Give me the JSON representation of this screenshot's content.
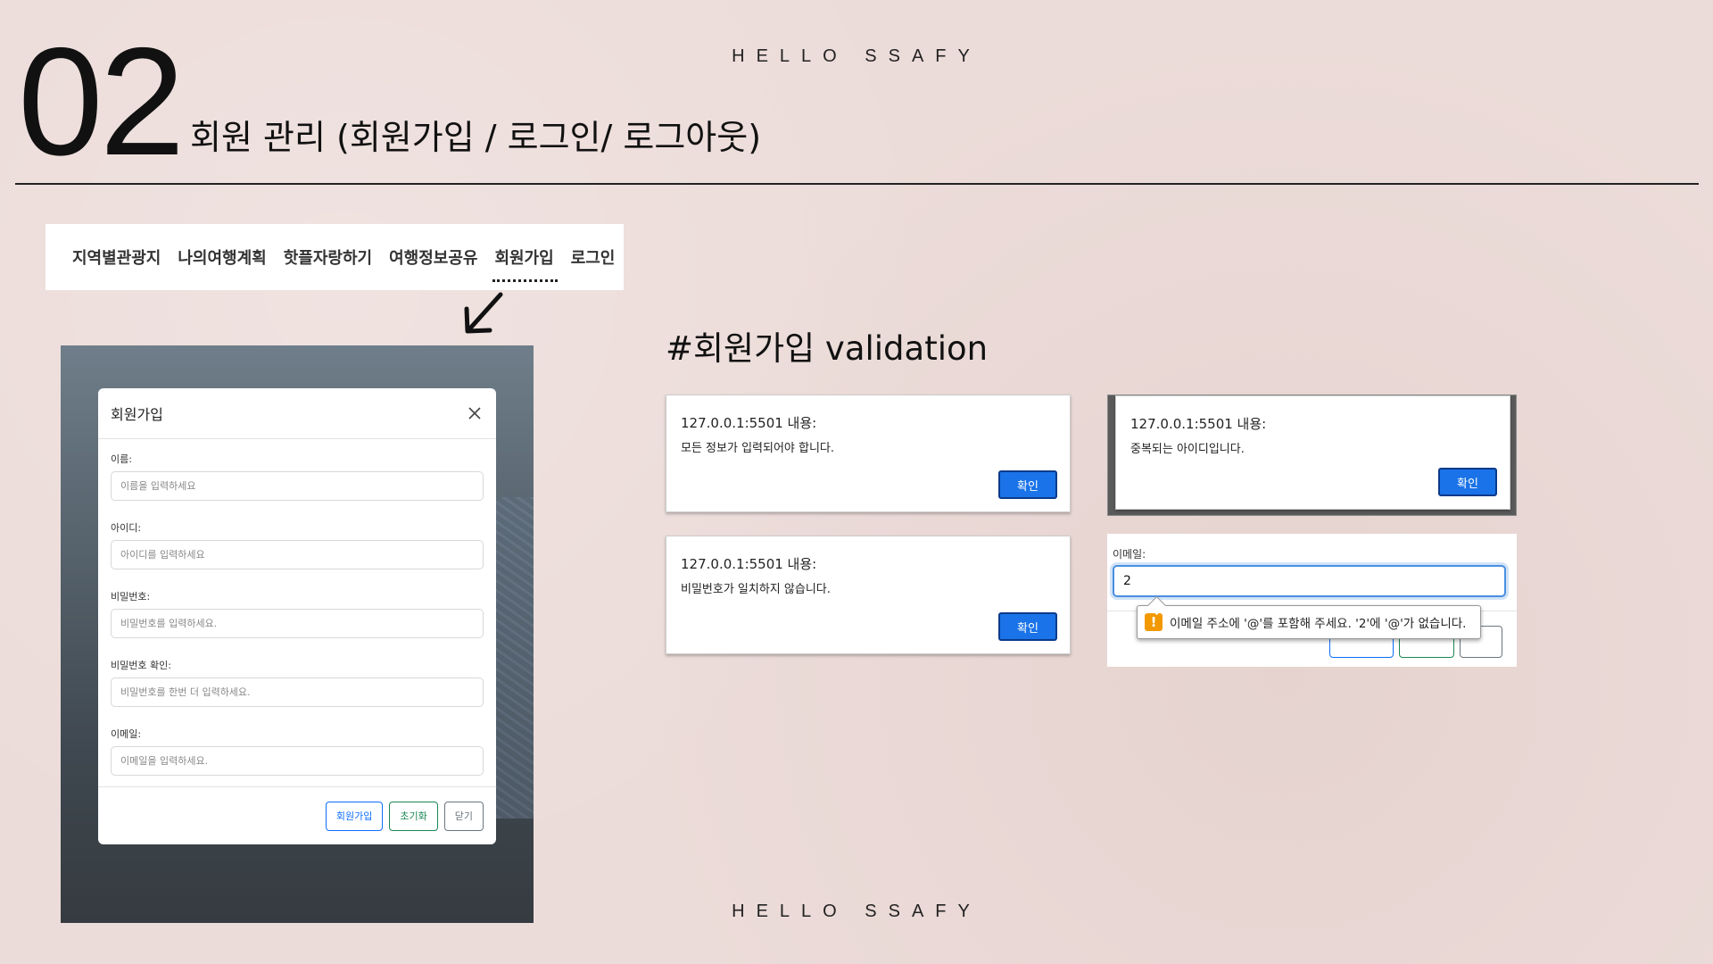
{
  "slide": {
    "tagline_top": "HELLO SSAFY",
    "tagline_bottom": "HELLO SSAFY",
    "number": "02",
    "title": "회원 관리 (회원가입 / 로그인/ 로그아웃)"
  },
  "nav": {
    "items": [
      "지역별관광지",
      "나의여행계획",
      "핫플자랑하기",
      "여행정보공유",
      "회원가입",
      "로그인"
    ],
    "active": "회원가입"
  },
  "signup_modal": {
    "title": "회원가입",
    "fields": [
      {
        "label": "이름:",
        "placeholder": "이름을 입력하세요"
      },
      {
        "label": "아이디:",
        "placeholder": "아이디를 입력하세요"
      },
      {
        "label": "비밀번호:",
        "placeholder": "비밀번호를 입력하세요."
      },
      {
        "label": "비밀번호 확인:",
        "placeholder": "비밀번호를 한번 더 입력하세요."
      },
      {
        "label": "이메일:",
        "placeholder": "이메일을 입력하세요."
      }
    ],
    "buttons": {
      "signup": "회원가입",
      "reset": "초기화",
      "close": "닫기"
    }
  },
  "validation": {
    "heading": "#회원가입 validation",
    "alerts": [
      {
        "origin": "127.0.0.1:5501 내용:",
        "message": "모든 정보가 입력되어야 합니다.",
        "ok": "확인"
      },
      {
        "origin": "127.0.0.1:5501 내용:",
        "message": "중복되는 아이디입니다.",
        "ok": "확인"
      },
      {
        "origin": "127.0.0.1:5501 내용:",
        "message": "비밀번호가 일치하지 않습니다.",
        "ok": "확인"
      }
    ],
    "email_check": {
      "label": "이메일:",
      "value": "2",
      "tooltip": "이메일 주소에 '@'를 포함해 주세요. '2'에 '@'가 없습니다."
    }
  },
  "colors": {
    "background": "#ecdcd9",
    "confirm_button": "#1a73e8",
    "primary": "#0d6efd",
    "success": "#198754",
    "warning": "#f29900"
  }
}
